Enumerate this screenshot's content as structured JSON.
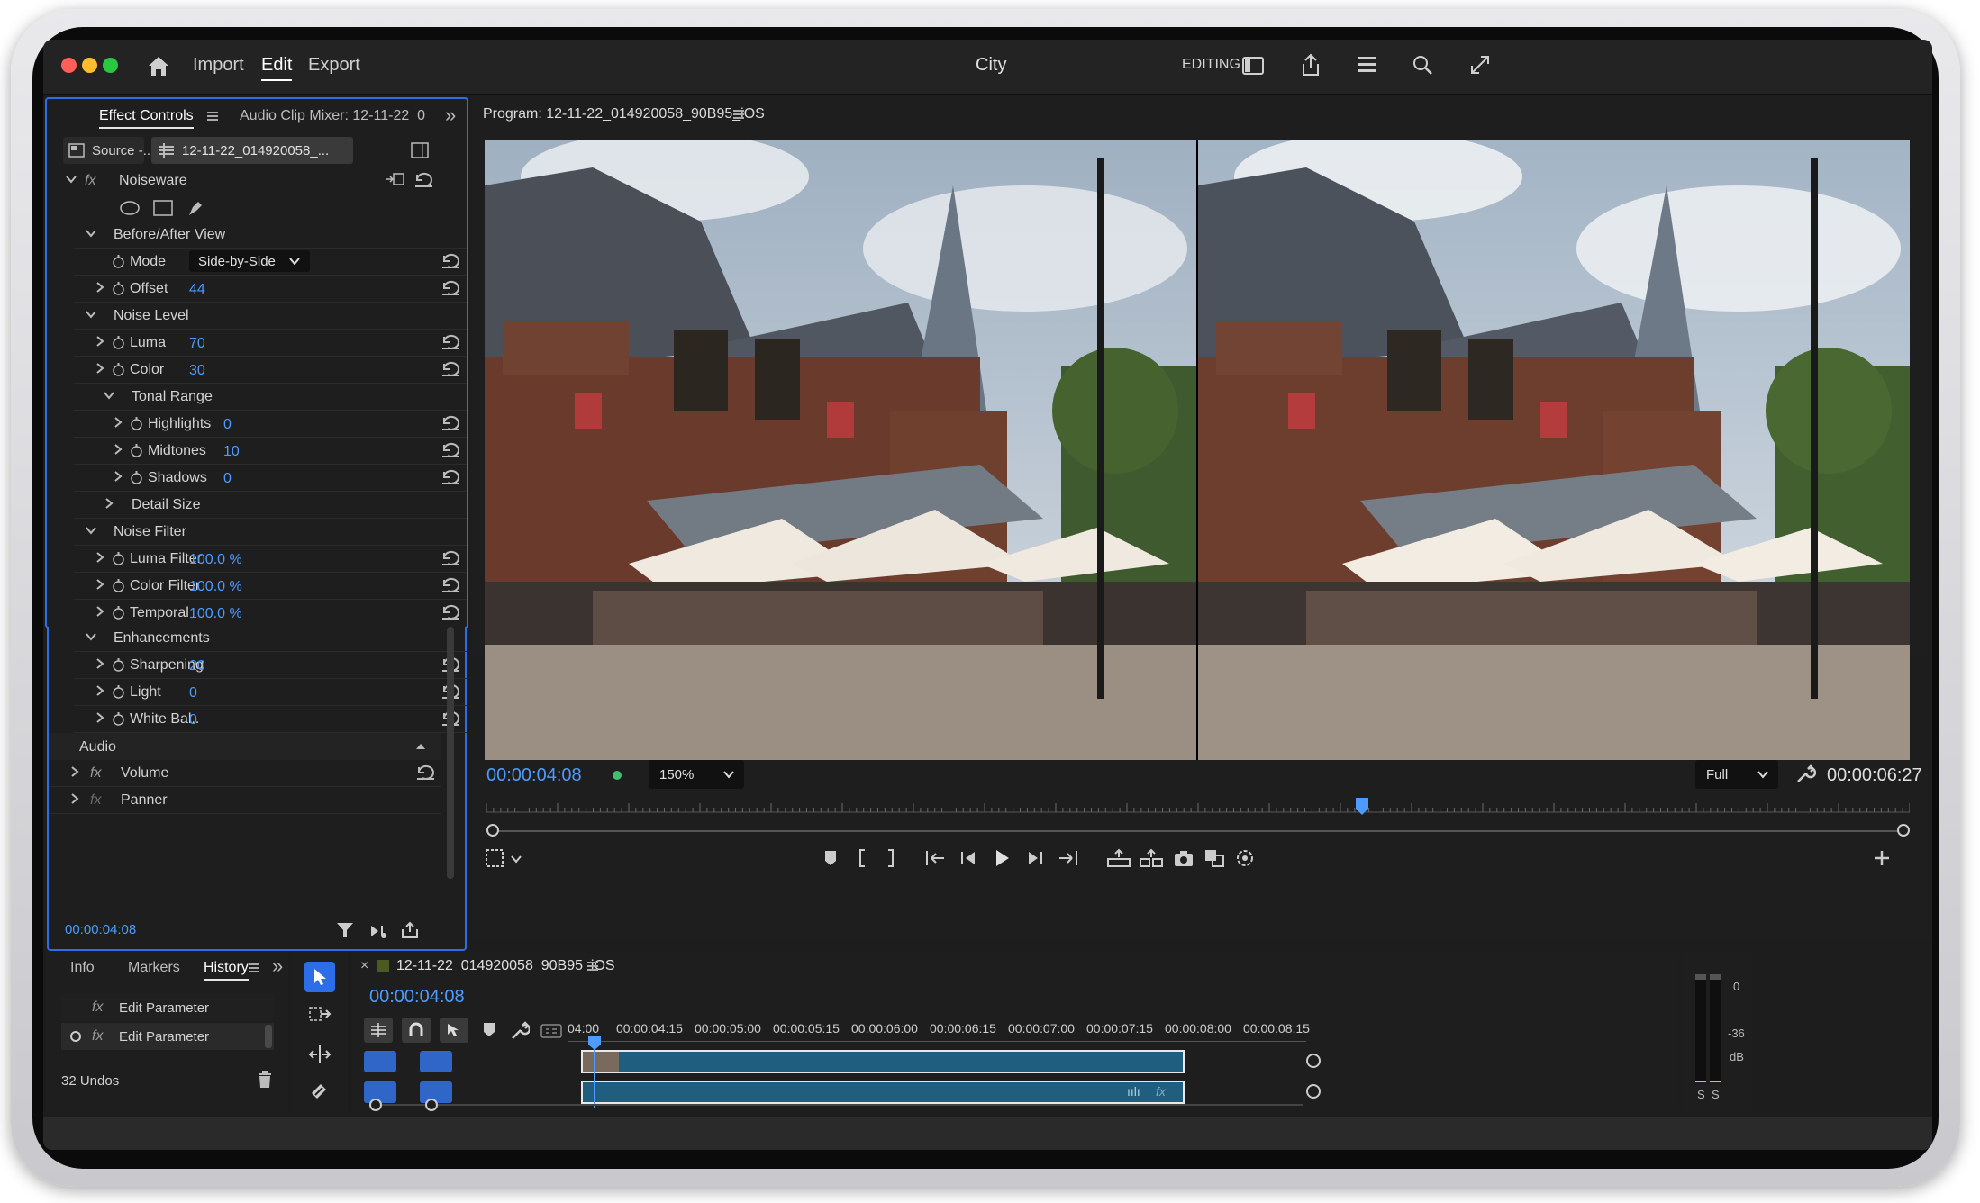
{
  "app": {
    "title": "City",
    "nav": [
      "Import",
      "Edit",
      "Export"
    ],
    "active_nav": "Edit",
    "workspace_label": "EDITING"
  },
  "effect_controls": {
    "tab_label": "Effect Controls",
    "audio_mixer_label": "Audio Clip Mixer: 12-11-22_0",
    "source_label": "Source -..",
    "clip_label": "12-11-22_014920058_...",
    "effect_name": "Noiseware",
    "rows": {
      "before_after": "Before/After View",
      "mode_label": "Mode",
      "mode_value": "Side-by-Side",
      "offset_label": "Offset",
      "offset_value": "44",
      "noise_level": "Noise Level",
      "luma_label": "Luma",
      "luma_value": "70",
      "color_label": "Color",
      "color_value": "30",
      "tonal_range": "Tonal Range",
      "highlights_label": "Highlights",
      "highlights_value": "0",
      "midtones_label": "Midtones",
      "midtones_value": "10",
      "shadows_label": "Shadows",
      "shadows_value": "0",
      "detail_size": "Detail Size",
      "noise_filter": "Noise Filter",
      "luma_filter_label": "Luma Filter",
      "luma_filter_value": "100.0 %",
      "color_filter_label": "Color Filter",
      "color_filter_value": "100.0 %",
      "temporal_label": "Temporal",
      "temporal_value": "100.0 %",
      "enhancements": "Enhancements",
      "sharpening_label": "Sharpening",
      "sharpening_value": "20",
      "light_label": "Light",
      "light_value": "0",
      "white_bal_label": "White Bal..",
      "white_bal_value": "0",
      "audio_label": "Audio",
      "volume_label": "Volume",
      "panner_label": "Panner"
    },
    "timecode": "00:00:04:08"
  },
  "program": {
    "title": "Program: 12-11-22_014920058_90B95_iOS",
    "timecode": "00:00:04:08",
    "zoom": "150%",
    "quality": "Full",
    "duration": "00:00:06:27",
    "playhead_fraction": 0.615
  },
  "history": {
    "tabs": [
      "Info",
      "Markers",
      "History"
    ],
    "active_tab": "History",
    "items": [
      "Edit Parameter",
      "Edit Parameter"
    ],
    "undos": "32 Undos"
  },
  "timeline": {
    "sequence_name": "12-11-22_014920058_90B95_iOS",
    "timecode": "00:00:04:08",
    "ruler_labels": [
      "04:00",
      "00:00:04:15",
      "00:00:05:00",
      "00:00:05:15",
      "00:00:06:00",
      "00:00:06:15",
      "00:00:07:00",
      "00:00:07:15",
      "00:00:08:00",
      "00:00:08:15"
    ]
  },
  "meter": {
    "labels": [
      "0",
      "-36",
      "dB"
    ],
    "solo": [
      "S",
      "S"
    ]
  },
  "colors": {
    "accent_blue": "#2d6ee8",
    "value_blue": "#4e9bff",
    "clip_teal": "#1f5e7f",
    "background": "#1d1d1d"
  }
}
